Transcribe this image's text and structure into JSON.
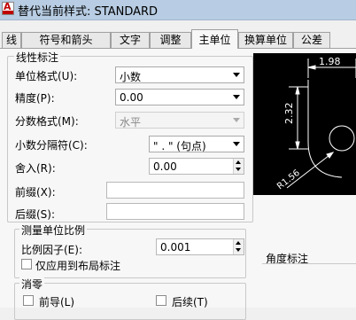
{
  "window": {
    "title": "替代当前样式: STANDARD"
  },
  "tabs": [
    {
      "label": "线"
    },
    {
      "label": "符号和箭头"
    },
    {
      "label": "文字"
    },
    {
      "label": "调整"
    },
    {
      "label": "主单位",
      "active": true
    },
    {
      "label": "换算单位"
    },
    {
      "label": "公差"
    }
  ],
  "linear": {
    "group_label": "线性标注",
    "unit_format": {
      "label": "单位格式(U):",
      "value": "小数"
    },
    "precision": {
      "label": "精度(P):",
      "value": "0.00"
    },
    "fraction_format": {
      "label": "分数格式(M):",
      "value": "水平"
    },
    "decimal_separator": {
      "label": "小数分隔符(C):",
      "value": "\" . \"  (句点)"
    },
    "round_off": {
      "label": "舍入(R):",
      "value": "0.00"
    },
    "prefix": {
      "label": "前缀(X):",
      "value": ""
    },
    "suffix": {
      "label": "后缀(S):",
      "value": ""
    }
  },
  "scale": {
    "group_label": "测量单位比例",
    "scale_factor": {
      "label": "比例因子(E):",
      "value": "0.001"
    },
    "layout_only": {
      "label": "仅应用到布局标注",
      "checked": false
    }
  },
  "zero_suppression": {
    "group_label": "消零",
    "leading": {
      "label": "前导(L)",
      "checked": false
    },
    "trailing": {
      "label": "后续(T)",
      "checked": false
    }
  },
  "preview": {
    "dim_horizontal": "1.98",
    "dim_vertical": "2.32",
    "dim_radius": "R1.56"
  },
  "angle": {
    "group_label": "角度标注"
  },
  "colors": {
    "titlebar": "#b8cde3",
    "preview_bg": "#000000",
    "preview_lines": "#ffffff"
  }
}
